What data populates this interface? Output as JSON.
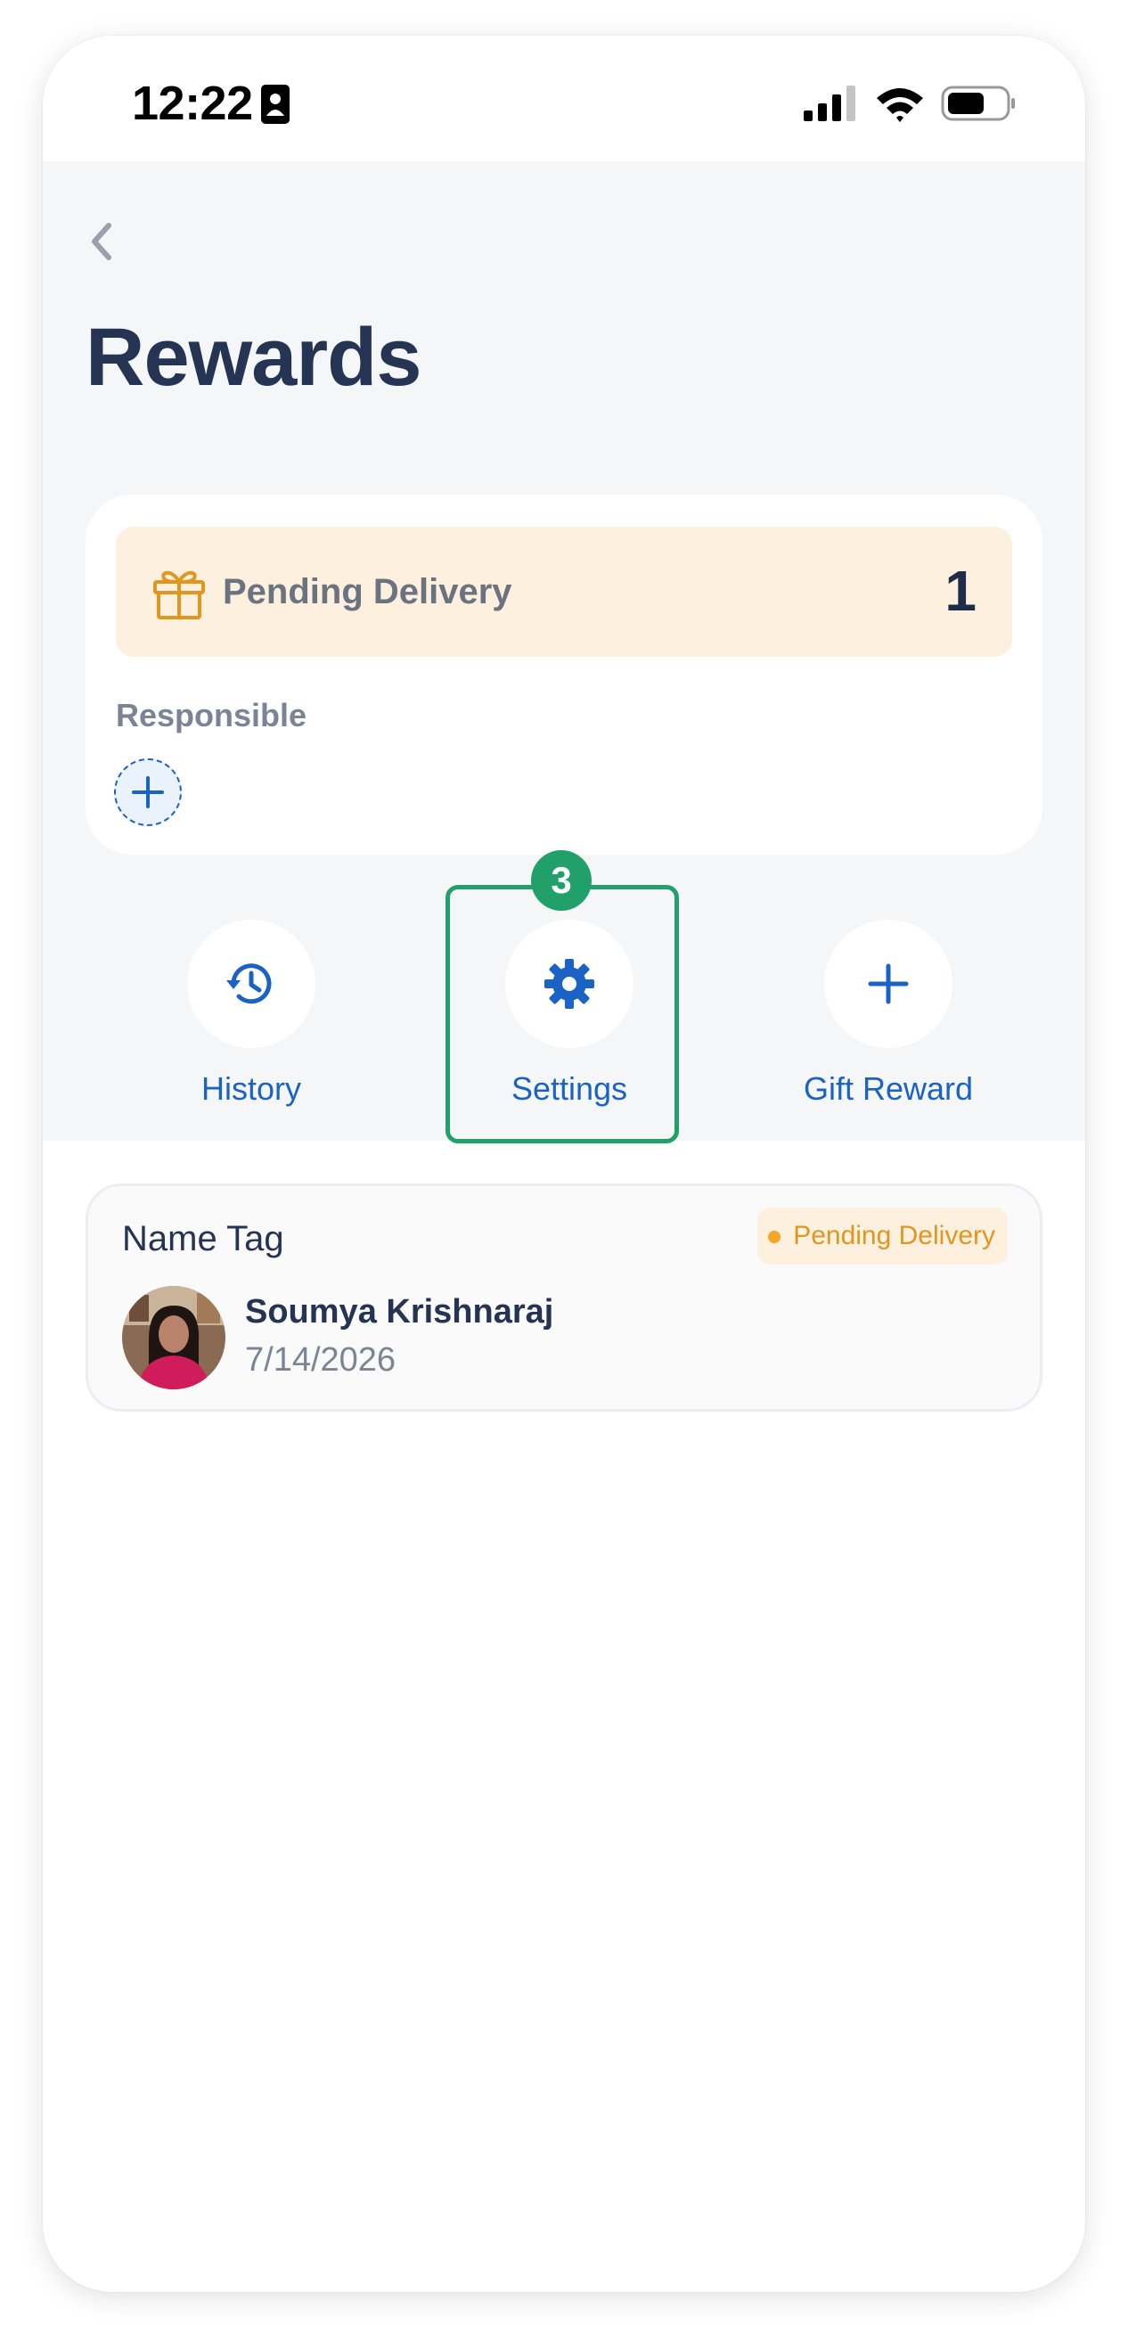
{
  "status_bar": {
    "time": "12:22"
  },
  "page": {
    "title": "Rewards"
  },
  "summary": {
    "pending_label": "Pending Delivery",
    "pending_count": "1",
    "responsible_label": "Responsible"
  },
  "actions": {
    "history": "History",
    "settings": "Settings",
    "gift_reward": "Gift Reward"
  },
  "annotation": {
    "step_number": "3"
  },
  "rewards_list": [
    {
      "name": "Name Tag",
      "status": "Pending Delivery",
      "person": "Soumya Krishnaraj",
      "date": "7/14/2026"
    }
  ],
  "colors": {
    "title": "#243452",
    "accent_blue": "#1a62c4",
    "pending_bg": "#fdf0df",
    "pending_orange": "#e0961f",
    "highlight_green": "#22a06b",
    "header_bg": "#f5f6f8"
  },
  "icons": {
    "back": "chevron-left-icon",
    "gift": "gift-icon",
    "add_responsible": "plus-icon",
    "history": "history-icon",
    "settings": "gear-icon",
    "gift_reward": "plus-icon"
  }
}
